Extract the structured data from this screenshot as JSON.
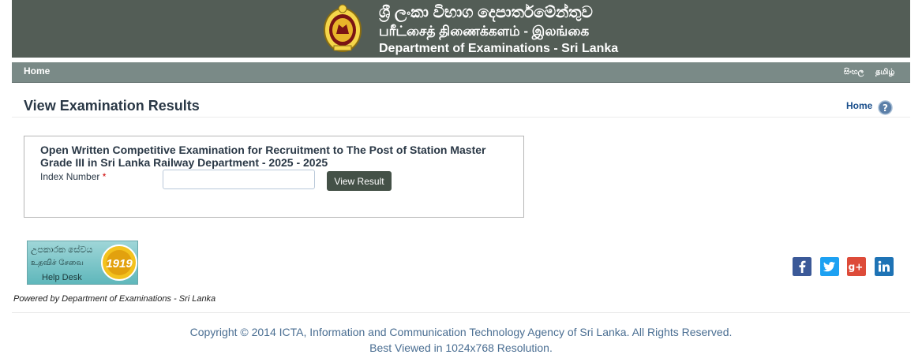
{
  "banner": {
    "title_sinhala": "ශ්‍රී ලංකා විභාග දෙපාර්තමේන්තුව",
    "title_tamil": "பரீட்சைத் திணைக்களம் - இலங்கை",
    "title_english": "Department of Examinations - Sri Lanka"
  },
  "nav": {
    "home_label": "Home",
    "lang_sinhala": "සිංහල",
    "lang_tamil": "தமிழ்"
  },
  "page": {
    "title": "View Examination Results",
    "home_link": "Home"
  },
  "exam": {
    "name": "Open Written Competitive Examination for Recruitment to The Post of Station Master Grade III in Sri Lanka Railway Department - 2025 - 2025",
    "index_label": "Index Number",
    "required_mark": "*",
    "index_value": "",
    "button_label": "View Result"
  },
  "helpdesk": {
    "sinhala_text": "උපකාරක සේවය",
    "tamil_text": "உதவிச் சேவை",
    "english_text": "Help Desk",
    "number": "1919"
  },
  "social": {
    "facebook_color": "#3b5998",
    "twitter_color": "#1da1f2",
    "google_color": "#dd4b39",
    "linkedin_color": "#1e73b5"
  },
  "footer": {
    "powered_by": "Powered by Department of Examinations - Sri Lanka",
    "copyright": "Copyright © 2014 ICTA, Information and Communication Technology Agency of Sri Lanka. All Rights Reserved.",
    "resolution": "Best Viewed in 1024x768 Resolution."
  }
}
